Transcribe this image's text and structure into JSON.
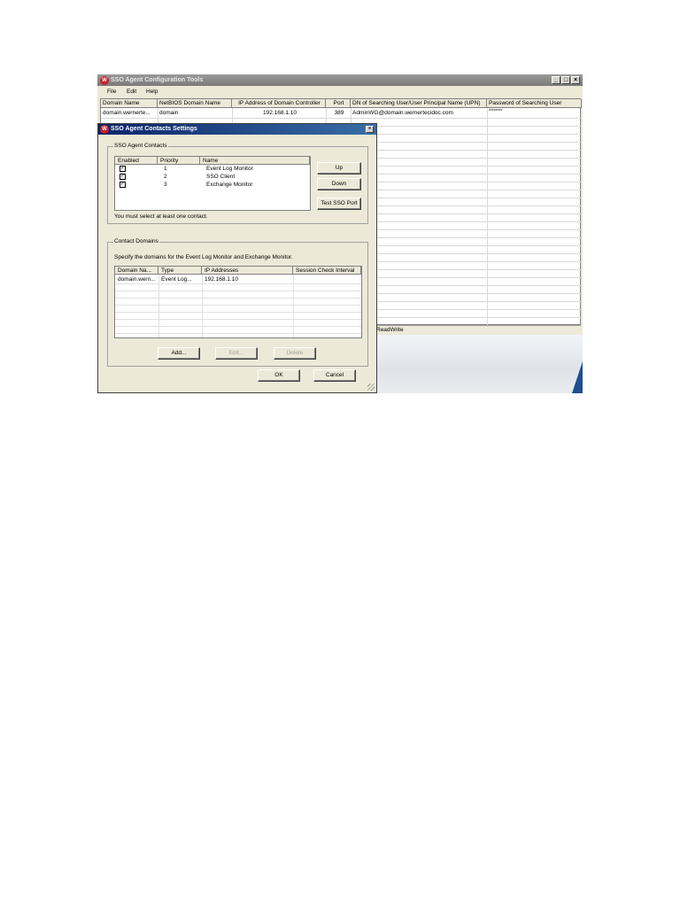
{
  "app": {
    "title": "SSO Agent Configuration Tools",
    "logo_text": "W",
    "window_controls": [
      "_",
      "□",
      "×"
    ],
    "menu": [
      "File",
      "Edit",
      "Help"
    ],
    "grid": {
      "columns": [
        "Domain Name",
        "NetBIOS Domain Name",
        "IP Address of Domain Controller",
        "Port",
        "DN of Searching User/User Principal Name (UPN)",
        "Password of Searching User"
      ],
      "rows": [
        [
          "domain.wernerte...",
          "domain",
          "192.168.1.10",
          "389",
          "AdminWG@domain.wernertecidoc.com",
          "********"
        ]
      ]
    },
    "status_text": "ReadWrite"
  },
  "dialog": {
    "title": "SSO Agent Contacts Settings",
    "close_label": "×",
    "contacts_group": {
      "label": "SSO Agent Contacts",
      "columns": [
        "Enabled",
        "Priority",
        "Name"
      ],
      "rows": [
        {
          "enabled": true,
          "priority": "1",
          "name": "Event Log Monitor"
        },
        {
          "enabled": true,
          "priority": "2",
          "name": "SSO Client"
        },
        {
          "enabled": true,
          "priority": "3",
          "name": "Exchange Monitor"
        }
      ],
      "up_label": "Up",
      "down_label": "Down",
      "test_label": "Test SSO Port",
      "hint": "You must select at least one contact."
    },
    "domains_group": {
      "label": "Contact Domains",
      "description": "Specify the domains for the Event Log Monitor and Exchange Monitor.",
      "columns": [
        "Domain Na...",
        "Type",
        "IP Addresses",
        "Session Check Interval"
      ],
      "rows": [
        [
          "domain.wern...",
          "Event Log...",
          "192.168.1.10",
          ""
        ]
      ],
      "add_label": "Add...",
      "edit_label": "Edit...",
      "delete_label": "Delete"
    },
    "ok_label": "OK",
    "cancel_label": "Cancel"
  }
}
